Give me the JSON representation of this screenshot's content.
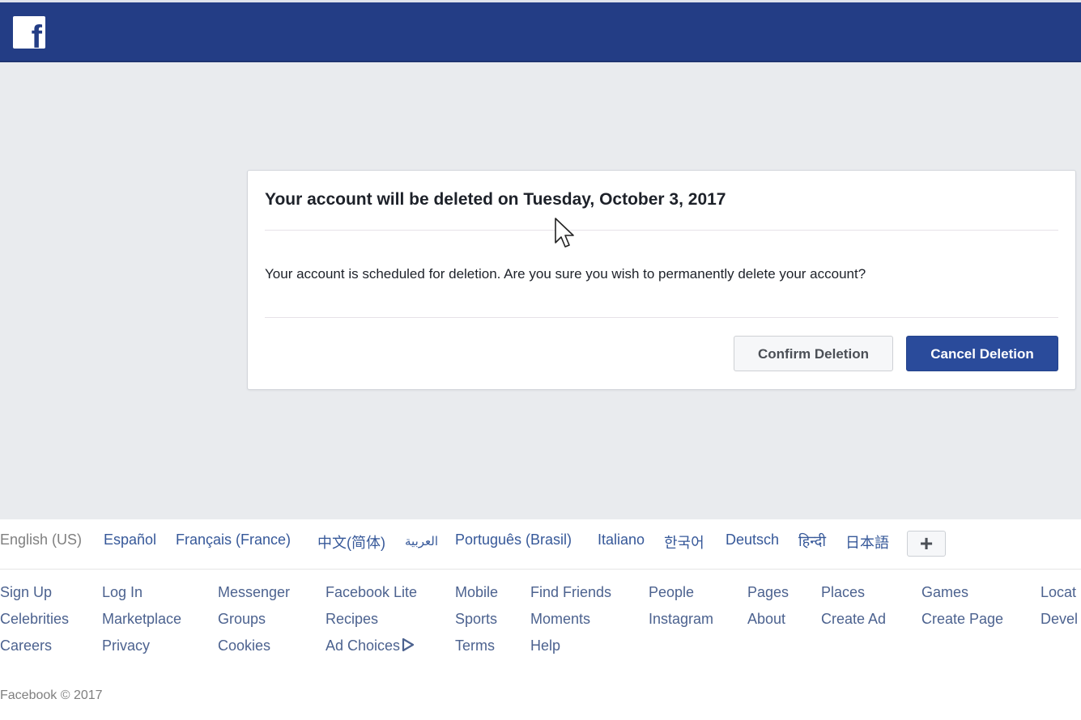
{
  "header": {
    "logo_icon": "facebook-f-logo",
    "logo_glyph": "f",
    "brand_color": "#233d85"
  },
  "dialog": {
    "title": "Your account will be deleted on Tuesday, October 3, 2017",
    "body": "Your account is scheduled for deletion. Are you sure you wish to permanently delete your account?",
    "confirm_label": "Confirm Deletion",
    "cancel_label": "Cancel Deletion",
    "primary_color": "#2a4b9b"
  },
  "footer": {
    "languages": [
      {
        "label": "English (US)",
        "current": true
      },
      {
        "label": "Español"
      },
      {
        "label": "Français (France)"
      },
      {
        "label": "中文(简体)"
      },
      {
        "label": "العربية"
      },
      {
        "label": "Português (Brasil)"
      },
      {
        "label": "Italiano"
      },
      {
        "label": "한국어"
      },
      {
        "label": "Deutsch"
      },
      {
        "label": "हिन्दी"
      },
      {
        "label": "日本語"
      }
    ],
    "more_languages_label": "+",
    "links": [
      [
        "Sign Up",
        "Celebrities",
        "Careers"
      ],
      [
        "Log In",
        "Marketplace",
        "Privacy"
      ],
      [
        "Messenger",
        "Groups",
        "Cookies"
      ],
      [
        "Facebook Lite",
        "Recipes",
        "Ad Choices"
      ],
      [
        "Mobile",
        "Sports",
        "Terms"
      ],
      [
        "Find Friends",
        "Moments",
        "Help"
      ],
      [
        "People",
        "Instagram"
      ],
      [
        "Pages",
        "About"
      ],
      [
        "Places",
        "Create Ad"
      ],
      [
        "Games",
        "Create Page"
      ],
      [
        "Locat",
        "Devel"
      ]
    ],
    "copyright": "Facebook © 2017"
  }
}
